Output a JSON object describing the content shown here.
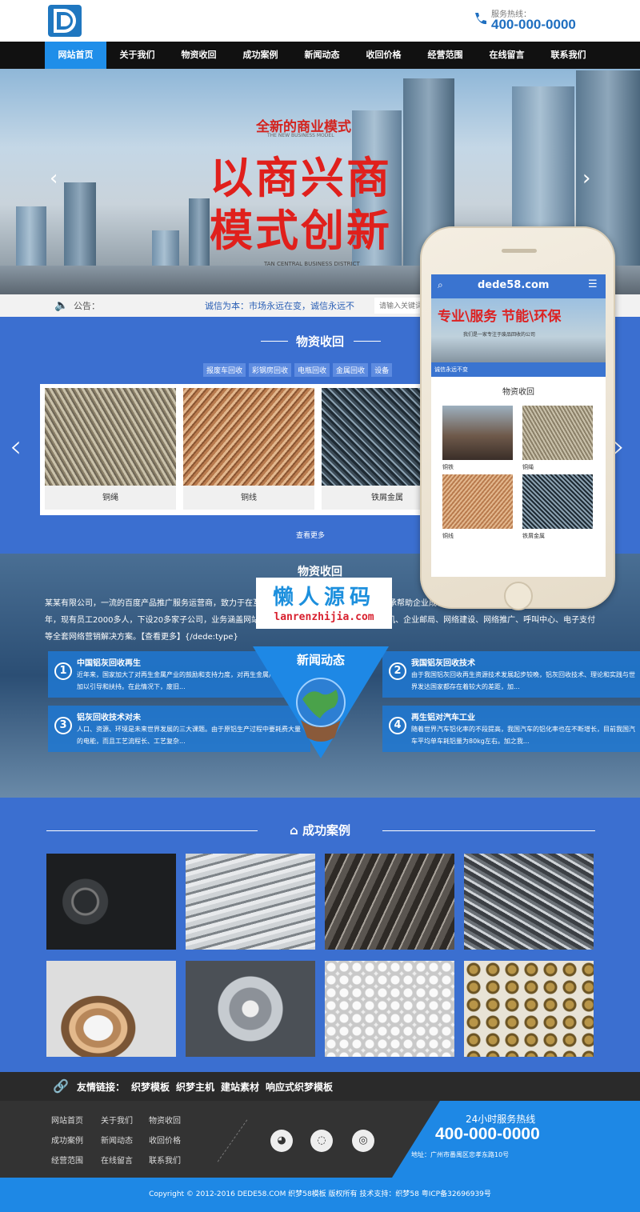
{
  "header": {
    "hotline_label": "服务热线：",
    "hotline_number": "400-000-0000"
  },
  "nav": [
    "网站首页",
    "关于我们",
    "物资收回",
    "成功案例",
    "新闻动态",
    "收回价格",
    "经营范围",
    "在线留言",
    "联系我们"
  ],
  "banner": {
    "subtitle": "全新的商业模式",
    "subtitle_en": "THE NEW BUSINESS MODEL",
    "headline1": "以商兴商",
    "headline2": "模式创新",
    "caption_en": "TAN CENTRAL BUSINESS DISTRICT"
  },
  "notice": {
    "label": "公告：",
    "text": "诚信为本：市场永远在变，诚信永远不",
    "search_placeholder": "请输入关键词"
  },
  "products": {
    "title": "物资收回",
    "tags": [
      "报废车回收",
      "彩钢房回收",
      "电瓶回收",
      "金属回收",
      "设备"
    ],
    "items": [
      "铜绳",
      "铜线",
      "铁屑金属"
    ],
    "more": "查看更多"
  },
  "about": {
    "title": "物资收回",
    "text": "某某有限公司，一流的百度产品推广服务运营商，致力于在互联网领域为企业提供全方位服务，秉承帮助企业成长的使命，并使他们获得成功，成立于2003年，现有员工2000多人，下设20多家子公司，业务涵盖网站建设、网络推广、域名注册、虚拟主机、企业邮局、网络建设、网络推广、呼叫中心、电子支付等全套网络营销解决方案。【查看更多】{/dede:type}"
  },
  "news": {
    "title": "新闻动态",
    "items": [
      {
        "num": "1",
        "title": "中国铝灰回收再生",
        "body": "近年来，国家加大了对再生金属产业的鼓励和支持力度，对再生金属产业的发展加以引导和扶持。在此情况下，废旧..."
      },
      {
        "num": "2",
        "title": "我国铝灰回收技术",
        "body": "由于我国铝灰回收再生资源技术发展起步较晚，铝灰回收技术、理论和实践与世界发达国家都存在着较大的差距，加..."
      },
      {
        "num": "3",
        "title": "铝灰回收技术对未",
        "body": "人口、资源、环境是未来世界发展的三大课题。由于原铝生产过程中要耗费大量的电能，而且工艺流程长、工艺复杂..."
      },
      {
        "num": "4",
        "title": "再生铝对汽车工业",
        "body": "随着世界汽车铝化率的不段提高，我国汽车的铝化率也在不断增长，目前我国汽车平均单车耗铝量为80kg左右。加之我..."
      }
    ]
  },
  "cases": {
    "title": "成功案例"
  },
  "links": {
    "label": "友情链接：",
    "items": [
      "织梦模板",
      "织梦主机",
      "建站素材",
      "响应式织梦模板"
    ]
  },
  "footer": {
    "nav": [
      "网站首页",
      "关于我们",
      "物资收回",
      "成功案例",
      "新闻动态",
      "收回价格",
      "经营范围",
      "在线留言",
      "联系我们"
    ],
    "hot_label": "24小时服务热线",
    "hot_number": "400-000-0000",
    "address": "地址：广州市番禺区忠孝东路10号"
  },
  "copyright": "Copyright © 2012-2016 DEDE58.COM 织梦58模板 版权所有     技术支持：织梦58     粤ICP备32696939号",
  "phone_screen": {
    "logo": "dede58.com",
    "slogan": "专业\\服务  节能\\环保",
    "slogan_sub": "我们是一家专注于废品回收的公司",
    "notice": "诚信永远不变",
    "section": "物资收回",
    "items": [
      "铜铁",
      "铜绳",
      "铜线",
      "铁屑金属"
    ]
  },
  "watermark": {
    "cn": "懒人源码",
    "url": "lanrenzhijia.com"
  },
  "colors": {
    "nav_active": "#1f8ee9",
    "section_blue": "#3b6fd0",
    "brand_blue": "#1f6fc0",
    "headline_red": "#e0201c"
  }
}
